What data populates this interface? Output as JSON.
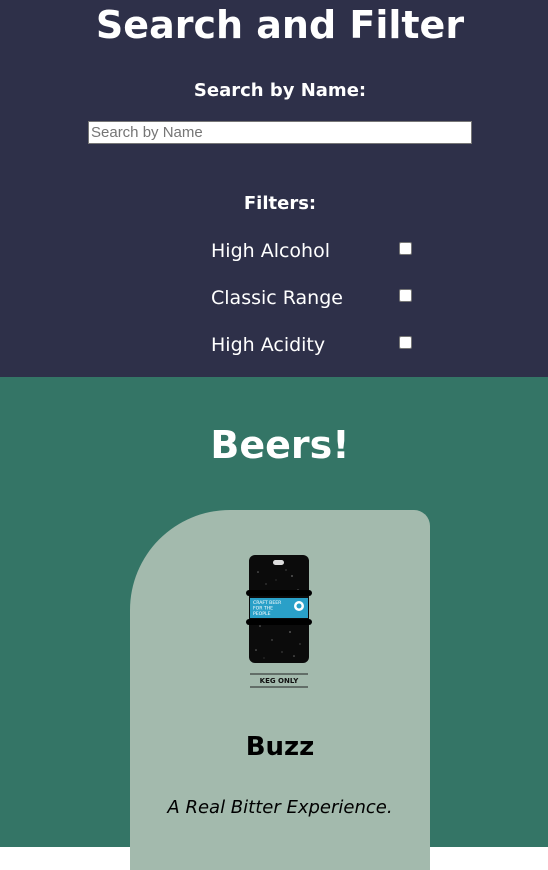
{
  "filter_panel": {
    "title": "Search and Filter",
    "search_label": "Search by Name:",
    "search_placeholder": "Search by Name",
    "search_value": "",
    "filters_label": "Filters:",
    "filters": [
      {
        "label": "High Alcohol",
        "checked": false
      },
      {
        "label": "Classic Range",
        "checked": false
      },
      {
        "label": "High Acidity",
        "checked": false
      }
    ]
  },
  "beers_section": {
    "title": "Beers!",
    "beers": [
      {
        "name": "Buzz",
        "tagline": "A Real Bitter Experience.",
        "image": {
          "icon": "keg-icon",
          "badge_text": [
            "CRAFT BEER",
            "FOR THE",
            "PEOPLE"
          ],
          "caption": "KEG ONLY"
        }
      }
    ]
  },
  "colors": {
    "filter_panel_bg": "#2e3049",
    "beers_section_bg": "#347566",
    "card_bg": "#a3baad",
    "text_light": "#ffffff"
  }
}
